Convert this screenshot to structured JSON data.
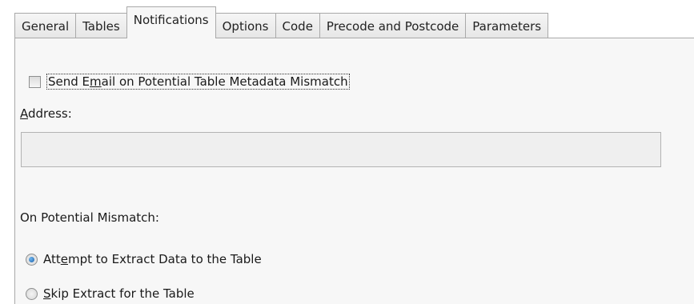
{
  "tabs": [
    {
      "label": "General",
      "active": false
    },
    {
      "label": "Tables",
      "active": false
    },
    {
      "label": "Notifications",
      "active": true
    },
    {
      "label": "Options",
      "active": false
    },
    {
      "label": "Code",
      "active": false
    },
    {
      "label": "Precode and Postcode",
      "active": false
    },
    {
      "label": "Parameters",
      "active": false
    }
  ],
  "notifications": {
    "send_email": {
      "label_pre": "Send E",
      "label_mnemonic": "m",
      "label_post": "ail on Potential Table Metadata Mismatch",
      "checked": false
    },
    "address": {
      "label_mnemonic": "A",
      "label_post": "ddress:",
      "value": "",
      "disabled": true
    },
    "on_mismatch": {
      "label": "On Potential Mismatch:",
      "options": [
        {
          "pre": "Att",
          "mnemonic": "e",
          "post": "mpt to Extract Data to the Table",
          "checked": true
        },
        {
          "pre": "",
          "mnemonic": "S",
          "post": "kip Extract for the Table",
          "checked": false
        }
      ]
    }
  }
}
